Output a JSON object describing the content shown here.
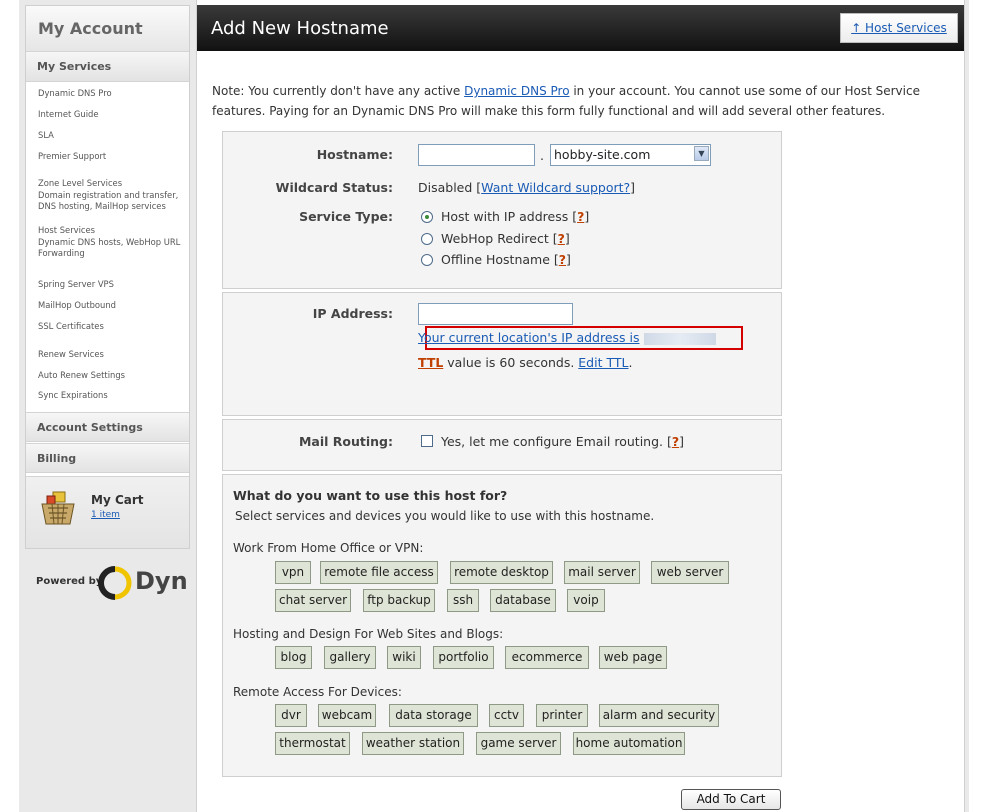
{
  "sidebar": {
    "title": "My Account",
    "my_services": "My Services",
    "items": [
      {
        "label": "Dynamic DNS Pro"
      },
      {
        "label": "Internet Guide"
      },
      {
        "label": "SLA"
      },
      {
        "label": "Premier Support"
      },
      {
        "label": "Zone Level Services",
        "sub": "Domain registration and transfer, DNS hosting, MailHop services"
      },
      {
        "label": "Host Services",
        "sub": "Dynamic DNS hosts, WebHop URL Forwarding"
      },
      {
        "label": "Spring Server VPS"
      },
      {
        "label": "MailHop Outbound"
      },
      {
        "label": "SSL Certificates"
      },
      {
        "label": "Renew Services"
      },
      {
        "label": "Auto Renew Settings"
      },
      {
        "label": "Sync Expirations"
      }
    ],
    "account_settings": "Account Settings",
    "billing": "Billing",
    "cart": {
      "title": "My Cart",
      "items": "1 item"
    },
    "powered_by": "Powered by",
    "brand": "Dyn"
  },
  "header": {
    "title": "Add New Hostname",
    "host_services_link": "↑ Host Services"
  },
  "note": {
    "prefix": "Note: You currently don't have any active ",
    "link": "Dynamic DNS Pro",
    "suffix": " in your account. You cannot use some of our Host Service features. Paying for an Dynamic DNS Pro will make this form fully functional and will add several other features."
  },
  "form": {
    "hostname_label": "Hostname:",
    "hostname_value": "",
    "dot": ".",
    "domain_selected": "hobby-site.com",
    "wildcard_label": "Wildcard Status:",
    "wildcard_value": "Disabled",
    "wildcard_link": "Want Wildcard support?",
    "service_type_label": "Service Type:",
    "service_types": [
      {
        "label": "Host with IP address",
        "checked": true
      },
      {
        "label": "WebHop Redirect",
        "checked": false
      },
      {
        "label": "Offline Hostname",
        "checked": false
      }
    ],
    "help": "?",
    "ip_label": "IP Address:",
    "ip_value": "",
    "current_ip_text": "Your current location's IP address is",
    "ttl_label": "TTL",
    "ttl_text": " value is 60 seconds. ",
    "edit_ttl": "Edit TTL",
    "mail_label": "Mail Routing:",
    "mail_checkbox": "Yes, let me configure Email routing."
  },
  "uses": {
    "title": "What do you want to use this host for?",
    "subtitle": "Select services and devices you would like to use with this hostname.",
    "groups": [
      {
        "title": "Work From Home Office or VPN:",
        "tags": [
          "vpn",
          "remote file access",
          "remote desktop",
          "mail server",
          "web server",
          "chat server",
          "ftp backup",
          "ssh",
          "database",
          "voip"
        ]
      },
      {
        "title": "Hosting and Design For Web Sites and Blogs:",
        "tags": [
          "blog",
          "gallery",
          "wiki",
          "portfolio",
          "ecommerce",
          "web page"
        ]
      },
      {
        "title": "Remote Access For Devices:",
        "tags": [
          "dvr",
          "webcam",
          "data storage",
          "cctv",
          "printer",
          "alarm and security",
          "thermostat",
          "weather station",
          "game server",
          "home automation"
        ]
      }
    ]
  },
  "add_to_cart": "Add To Cart"
}
